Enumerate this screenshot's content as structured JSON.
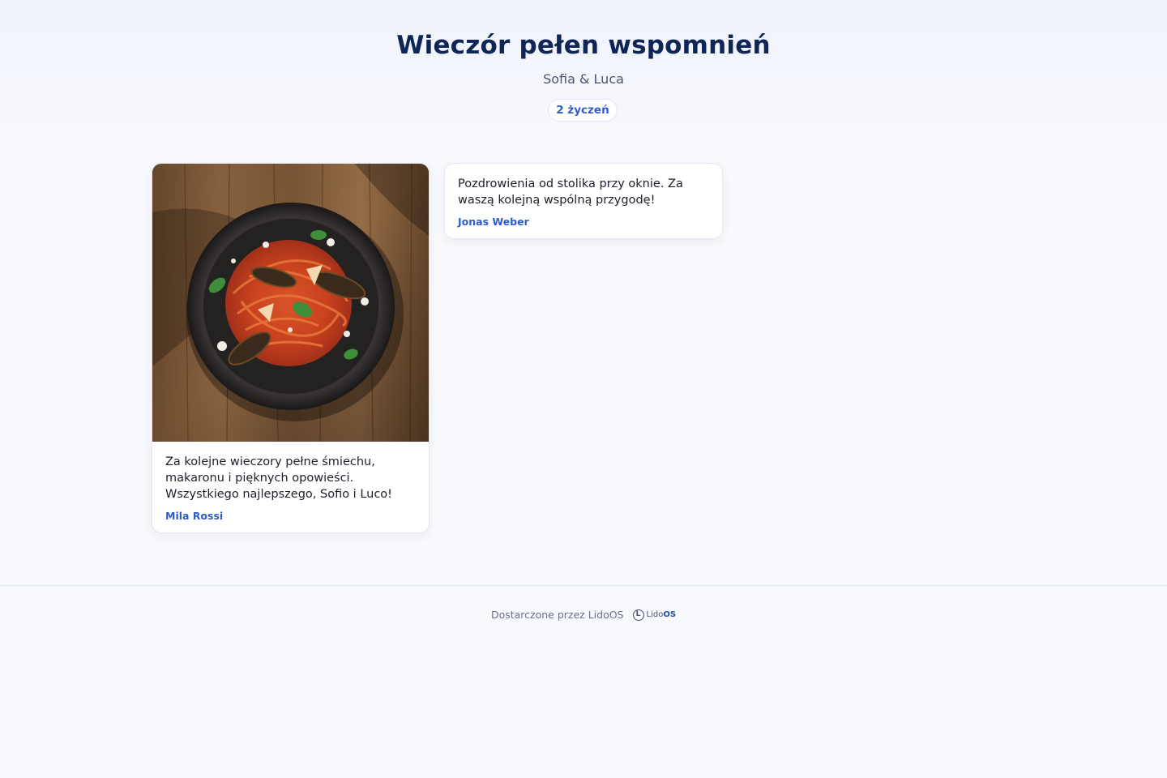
{
  "header": {
    "title": "Wieczór pełen wspomnień",
    "subtitle": "Sofia & Luca",
    "count_badge": "2 życzeń"
  },
  "cards": [
    {
      "has_photo": true,
      "photo_description_icon": "photo-pasta-dish",
      "message": "Za kolejne wieczory pełne śmiechu, makaronu i pięknych opowieści. Wszystkiego najlepszego, Sofio i Luco!",
      "author": "Mila Rossi"
    },
    {
      "has_photo": false,
      "message": "Pozdrowienia od stolika przy oknie. Za waszą kolejną wspólną przygodę!",
      "author": "Jonas Weber"
    }
  ],
  "footer": {
    "powered_by": "Dostarczone przez LidoOS",
    "brand_mark": "L",
    "brand_name": "Lido",
    "brand_suffix": "OS"
  },
  "colors": {
    "title": "#0f2556",
    "accent": "#2d5bc9",
    "background": "#f8f9fd"
  }
}
